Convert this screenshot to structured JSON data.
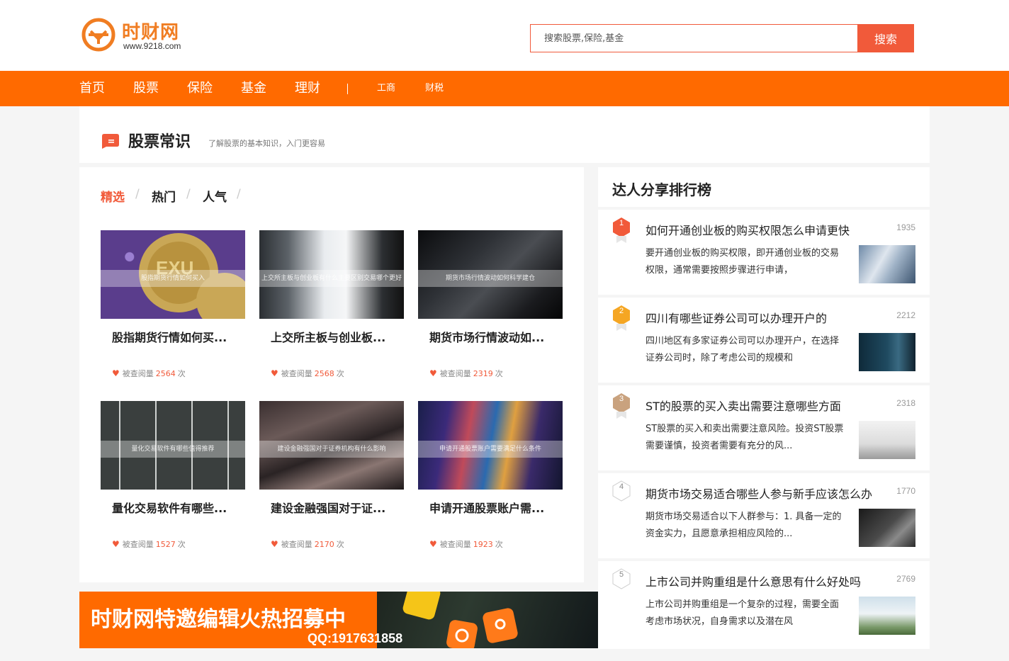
{
  "header": {
    "logo_name": "时财网",
    "logo_url": "www.9218.com",
    "search_placeholder": "搜索股票,保险,基金",
    "search_button": "搜索"
  },
  "colors": {
    "accent": "#ff6a00",
    "brand_red": "#f15a3a",
    "logo_orange": "#f07d22"
  },
  "nav": {
    "items": [
      "首页",
      "股票",
      "保险",
      "基金",
      "理财"
    ],
    "small_items": [
      "工商",
      "财税"
    ],
    "separator": "|"
  },
  "section": {
    "title": "股票常识",
    "subtitle": "了解股票的基本知识，入门更容易"
  },
  "tabs": [
    "精选",
    "热门",
    "人气"
  ],
  "cards": [
    {
      "title": "股指期货行情如何买...",
      "overlay": "股指期货行情如何买入",
      "meta_prefix": "被查阅量",
      "views": "2564",
      "meta_suffix": "次"
    },
    {
      "title": "上交所主板与创业板...",
      "overlay": "上交所主板与创业板有什么主要区别交易哪个更好",
      "meta_prefix": "被查阅量",
      "views": "2568",
      "meta_suffix": "次"
    },
    {
      "title": "期货市场行情波动如...",
      "overlay": "期货市场行情波动如何科学建仓",
      "meta_prefix": "被查阅量",
      "views": "2319",
      "meta_suffix": "次"
    },
    {
      "title": "量化交易软件有哪些...",
      "overlay": "量化交易软件有哪些值得推荐",
      "meta_prefix": "被查阅量",
      "views": "1527",
      "meta_suffix": "次"
    },
    {
      "title": "建设金融强国对于证...",
      "overlay": "建设金融强国对于证券机构有什么影响",
      "meta_prefix": "被查阅量",
      "views": "2170",
      "meta_suffix": "次"
    },
    {
      "title": "申请开通股票账户需...",
      "overlay": "申请开通股票账户需要满足什么条件",
      "meta_prefix": "被查阅量",
      "views": "1923",
      "meta_suffix": "次"
    }
  ],
  "banner": {
    "text": "时财网特邀编辑火热招募中",
    "qq": "QQ:1917631858"
  },
  "ranking": {
    "title": "达人分享排行榜",
    "items": [
      {
        "rank": "1",
        "title": "如何开通创业板的购买权限怎么申请更快",
        "count": "1935",
        "desc": "要开通创业板的购买权限，即开通创业板的交易权限，通常需要按照步骤进行申请，",
        "badge_color": "#f15a3a"
      },
      {
        "rank": "2",
        "title": "四川有哪些证券公司可以办理开户的",
        "count": "2212",
        "desc": "四川地区有多家证券公司可以办理开户，在选择证券公司时，除了考虑公司的规模和",
        "badge_color": "#f5a623"
      },
      {
        "rank": "3",
        "title": "ST的股票的买入卖出需要注意哪些方面",
        "count": "2318",
        "desc": "ST股票的买入和卖出需要注意风险。投资ST股票需要谨慎，投资者需要有充分的风...",
        "badge_color": "#c9a27e"
      },
      {
        "rank": "4",
        "title": "期货市场交易适合哪些人参与新手应该怎么办",
        "count": "1770",
        "desc": "期货市场交易适合以下人群参与：1. 具备一定的资金实力，且愿意承担相应风险的...",
        "badge_color": "#ffffff"
      },
      {
        "rank": "5",
        "title": "上市公司并购重组是什么意思有什么好处吗",
        "count": "2769",
        "desc": "上市公司并购重组是一个复杂的过程，需要全面考虑市场状况，自身需求以及潜在风",
        "badge_color": "#ffffff"
      }
    ]
  }
}
